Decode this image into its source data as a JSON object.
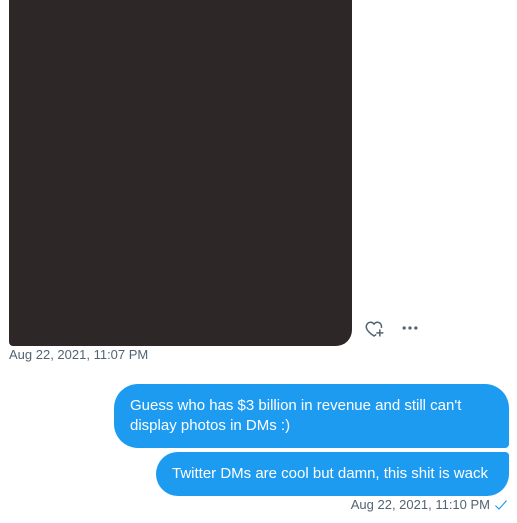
{
  "conversation": {
    "received": {
      "media": "photo",
      "timestamp": "Aug 22, 2021, 11:07 PM",
      "actions": {
        "react_icon": "heart-plus-icon",
        "more_icon": "more-horizontal-icon"
      }
    },
    "sent": {
      "messages": [
        {
          "text": "Guess who has $3 billion in revenue and still can't display photos in DMs :)"
        },
        {
          "text": "Twitter DMs are cool but damn, this shit is wack"
        }
      ],
      "timestamp": "Aug 22, 2021, 11:10 PM",
      "status_icon": "seen-check-icon"
    }
  },
  "colors": {
    "bubble": "#1d9bf0",
    "bubble_text": "#ffffff",
    "timestamp": "#536471",
    "media_placeholder": "#2d2827",
    "icon": "#536471"
  }
}
